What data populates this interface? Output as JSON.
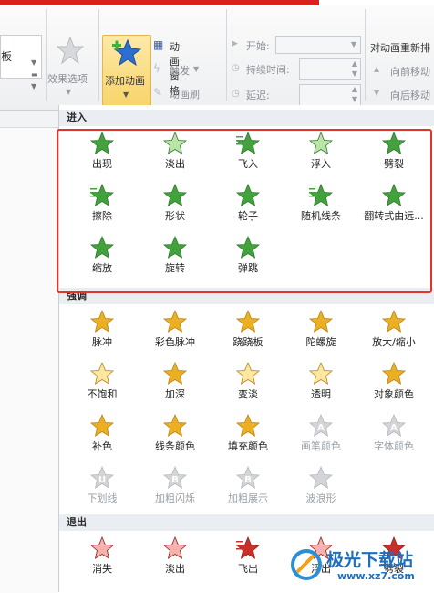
{
  "ribbon": {
    "partial_left_label": "板",
    "effect_options": "效果选项",
    "add_animation": "添加动画",
    "animation_pane": "动画窗格",
    "trigger": "触发",
    "animation_painter": "动画刷",
    "start_label": "开始:",
    "duration_label": "持续时间:",
    "delay_label": "延迟:",
    "reorder_title": "对动画重新排",
    "move_earlier": "向前移动",
    "move_later": "向后移动"
  },
  "sections": [
    {
      "title": "进入",
      "items": [
        {
          "label": "出现",
          "icon": "appear-star-icon"
        },
        {
          "label": "淡出",
          "icon": "fade-star-icon"
        },
        {
          "label": "飞入",
          "icon": "fly-in-star-icon"
        },
        {
          "label": "浮入",
          "icon": "float-in-star-icon"
        },
        {
          "label": "劈裂",
          "icon": "split-star-icon"
        },
        {
          "label": "擦除",
          "icon": "wipe-star-icon"
        },
        {
          "label": "形状",
          "icon": "shape-star-icon"
        },
        {
          "label": "轮子",
          "icon": "wheel-star-icon"
        },
        {
          "label": "随机线条",
          "icon": "random-bars-star-icon"
        },
        {
          "label": "翻转式由远...",
          "icon": "grow-turn-star-icon"
        },
        {
          "label": "缩放",
          "icon": "zoom-star-icon"
        },
        {
          "label": "旋转",
          "icon": "swivel-star-icon"
        },
        {
          "label": "弹跳",
          "icon": "bounce-star-icon"
        }
      ]
    },
    {
      "title": "强调",
      "items": [
        {
          "label": "脉冲",
          "icon": "pulse-star-icon"
        },
        {
          "label": "彩色脉冲",
          "icon": "color-pulse-star-icon"
        },
        {
          "label": "跷跷板",
          "icon": "teeter-star-icon"
        },
        {
          "label": "陀螺旋",
          "icon": "spin-star-icon"
        },
        {
          "label": "放大/缩小",
          "icon": "grow-shrink-star-icon"
        },
        {
          "label": "不饱和",
          "icon": "desaturate-star-icon"
        },
        {
          "label": "加深",
          "icon": "darken-star-icon"
        },
        {
          "label": "变淡",
          "icon": "lighten-star-icon"
        },
        {
          "label": "透明",
          "icon": "transparency-star-icon"
        },
        {
          "label": "对象颜色",
          "icon": "object-color-star-icon"
        },
        {
          "label": "补色",
          "icon": "complementary-color-star-icon"
        },
        {
          "label": "线条颜色",
          "icon": "line-color-star-icon"
        },
        {
          "label": "填充颜色",
          "icon": "fill-color-star-icon"
        },
        {
          "label": "画笔颜色",
          "icon": "brush-color-icon"
        },
        {
          "label": "字体颜色",
          "icon": "font-color-icon"
        },
        {
          "label": "下划线",
          "icon": "underline-icon"
        },
        {
          "label": "加粗闪烁",
          "icon": "bold-flash-icon"
        },
        {
          "label": "加粗展示",
          "icon": "bold-reveal-icon"
        },
        {
          "label": "波浪形",
          "icon": "wave-star-icon"
        }
      ]
    },
    {
      "title": "退出",
      "items": [
        {
          "label": "消失",
          "icon": "disappear-star-icon"
        },
        {
          "label": "淡出",
          "icon": "fade-out-star-icon"
        },
        {
          "label": "飞出",
          "icon": "fly-out-star-icon"
        },
        {
          "label": "浮出",
          "icon": "float-out-star-icon"
        },
        {
          "label": "劈裂",
          "icon": "split-out-star-icon"
        }
      ]
    }
  ],
  "watermark": {
    "name": "极光下载站",
    "url": "www.xz7.com"
  },
  "colors": {
    "entrance": "#3f9a3a",
    "emphasis": "#e3a81c",
    "exit": "#c0302a",
    "highlight": "#e0352b"
  }
}
